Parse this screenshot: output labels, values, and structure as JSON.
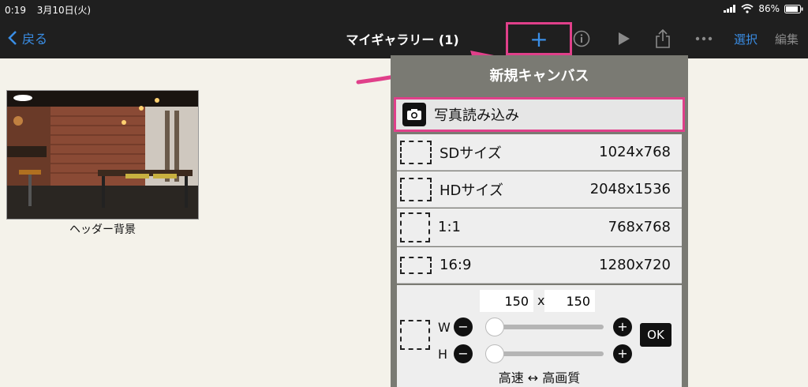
{
  "status": {
    "time": "0:19",
    "date": "3月10日(火)",
    "battery": "86%"
  },
  "nav": {
    "back_label": "戻る",
    "title": "マイギャラリー (1)",
    "add_label": "+",
    "select_label": "選択",
    "edit_label": "編集"
  },
  "gallery": {
    "items": [
      {
        "caption": "ヘッダー背景"
      }
    ]
  },
  "popover": {
    "title": "新規キャンバス",
    "import_label": "写真読み込み",
    "presets": [
      {
        "name": "SDサイズ",
        "size": "1024x768"
      },
      {
        "name": "HDサイズ",
        "size": "2048x1536"
      },
      {
        "name": "1:1",
        "size": "768x768"
      },
      {
        "name": "16:9",
        "size": "1280x720"
      }
    ],
    "custom": {
      "width": "150",
      "separator": "x",
      "height": "150",
      "w_label": "W",
      "h_label": "H",
      "minus": "−",
      "plus": "+",
      "ok_label": "OK",
      "quality_label": "高速 ↔ 高画質"
    }
  },
  "colors": {
    "accent": "#3a8ee6",
    "highlight": "#e0408a",
    "bar": "#1f1f1f"
  }
}
